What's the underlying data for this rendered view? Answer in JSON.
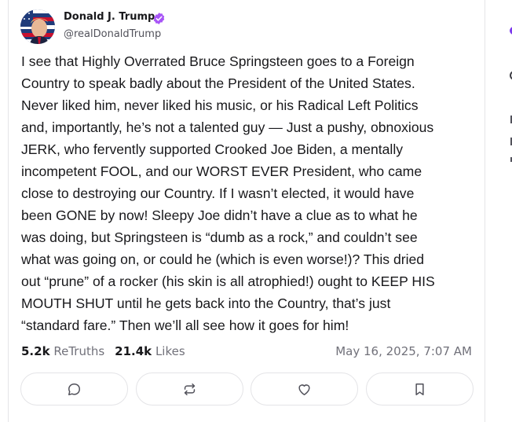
{
  "author": {
    "display_name": "Donald J. Trump",
    "handle": "@realDonaldTrump",
    "verified_color": "#a855f7"
  },
  "post": {
    "lines": [
      "I see that Highly Overrated Bruce Springsteen goes to a Foreign",
      "Country to speak badly about the President of the United States.",
      "Never liked him, never liked his music, or his Radical Left Politics",
      "and, importantly, he’s not a talented guy — Just a pushy, obnoxious",
      "JERK, who fervently supported Crooked Joe Biden, a mentally",
      "incompetent FOOL, and our WORST EVER President, who came",
      "close to destroying our Country. If I wasn’t elected, it would have",
      "been GONE by now! Sleepy Joe didn’t have a clue as to what he",
      "was doing, but Springsteen is “dumb as a rock,” and couldn’t see",
      "what was going on, or could he (which is even worse!)? This dried",
      "out “prune” of a rocker (his skin is all atrophied!) ought to KEEP HIS",
      "MOUTH SHUT until he gets back into the Country, that’s just",
      "“standard fare.” Then we’ll all see how it goes for him!"
    ]
  },
  "stats": {
    "retruths_count": "5.2k",
    "retruths_label": "ReTruths",
    "likes_count": "21.4k",
    "likes_label": "Likes",
    "timestamp": "May 16, 2025, 7:07 AM"
  },
  "actions": {
    "icons": [
      "reply-icon",
      "retruth-icon",
      "like-icon",
      "bookmark-icon"
    ]
  },
  "colors": {
    "text": "#18181b",
    "muted": "#71717a",
    "border": "#e4e4e7",
    "accent": "#7c3aed"
  }
}
